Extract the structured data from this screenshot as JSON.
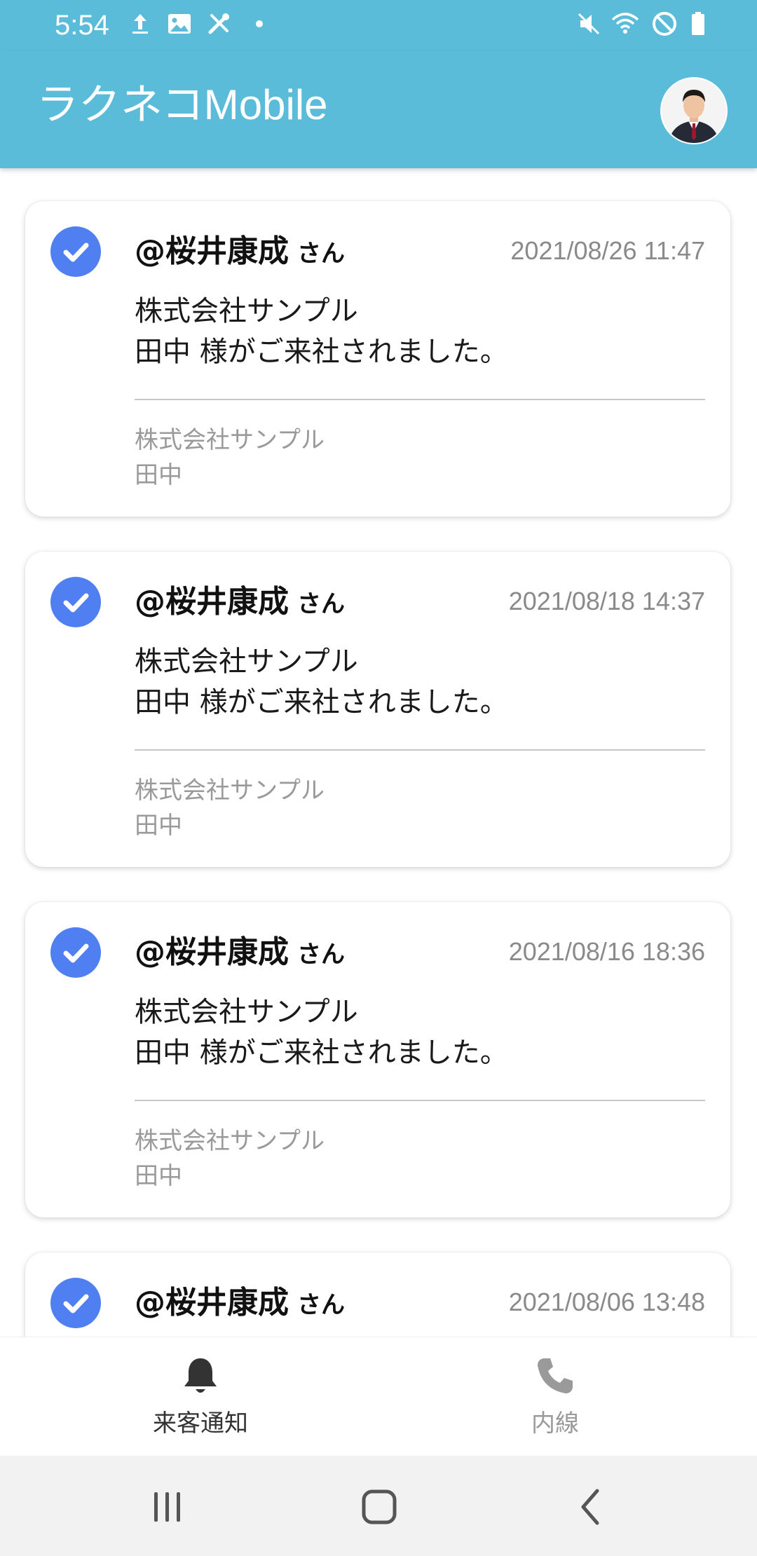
{
  "status_bar": {
    "time": "5:54",
    "left_icons": [
      "upload-icon",
      "image-icon",
      "tools-icon",
      "dot-icon"
    ],
    "right_icons": [
      "mute-icon",
      "wifi-icon",
      "do-not-disturb-icon",
      "battery-icon"
    ]
  },
  "app_bar": {
    "title": "ラクネコMobile",
    "avatar": "profile-avatar"
  },
  "notifications": [
    {
      "sender": "@桜井康成",
      "honorific": "さん",
      "datetime": "2021/08/26 11:47",
      "message_line1": "株式会社サンプル",
      "message_line2": "田中 様がご来社されました。",
      "company": "株式会社サンプル",
      "visitor": "田中"
    },
    {
      "sender": "@桜井康成",
      "honorific": "さん",
      "datetime": "2021/08/18 14:37",
      "message_line1": "株式会社サンプル",
      "message_line2": "田中 様がご来社されました。",
      "company": "株式会社サンプル",
      "visitor": "田中"
    },
    {
      "sender": "@桜井康成",
      "honorific": "さん",
      "datetime": "2021/08/16 18:36",
      "message_line1": "株式会社サンプル",
      "message_line2": "田中 様がご来社されました。",
      "company": "株式会社サンプル",
      "visitor": "田中"
    },
    {
      "sender": "@桜井康成",
      "honorific": "さん",
      "datetime": "2021/08/06 13:48"
    }
  ],
  "bottom_nav": {
    "items": [
      {
        "label": "来客通知",
        "icon": "bell-icon",
        "active": true
      },
      {
        "label": "内線",
        "icon": "phone-icon",
        "active": false
      }
    ]
  },
  "colors": {
    "app_bar": "#5bbcd9",
    "check": "#4f7ff0",
    "active_nav": "#333333",
    "inactive_nav": "#9a9a9a"
  }
}
